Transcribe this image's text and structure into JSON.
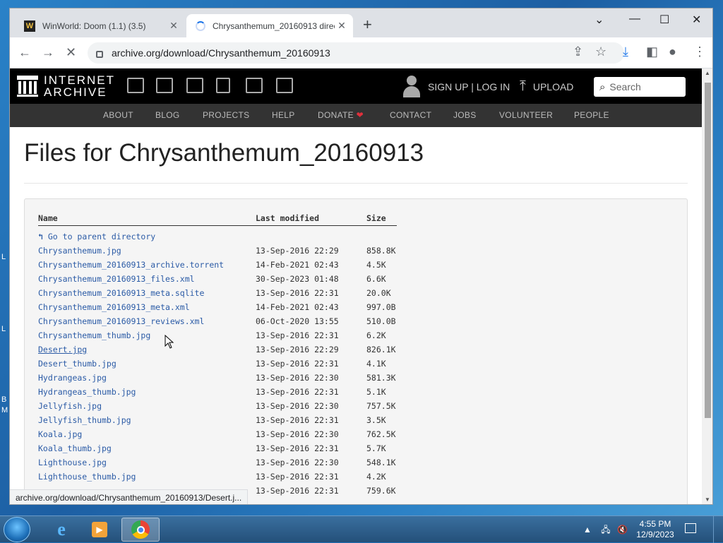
{
  "browser": {
    "tabs": [
      {
        "title": "WinWorld: Doom (1.1) (3.5)",
        "favicon": "W"
      },
      {
        "title": "Chrysanthemum_20160913 direc"
      }
    ],
    "url": "archive.org/download/Chrysanthemum_20160913",
    "status_url": "archive.org/download/Chrysanthemum_20160913/Desert.j..."
  },
  "ia": {
    "logo_line1": "INTERNET",
    "logo_line2": "ARCHIVE",
    "signup": "SIGN UP | LOG IN",
    "upload": "UPLOAD",
    "search_placeholder": "Search",
    "nav": [
      "ABOUT",
      "BLOG",
      "PROJECTS",
      "HELP",
      "DONATE",
      "CONTACT",
      "JOBS",
      "VOLUNTEER",
      "PEOPLE"
    ]
  },
  "page": {
    "title": "Files for Chrysanthemum_20160913",
    "columns": {
      "name": "Name",
      "modified": "Last modified",
      "size": "Size"
    },
    "parent": "Go to parent directory",
    "files": [
      {
        "name": "Chrysanthemum.jpg",
        "modified": "13-Sep-2016 22:29",
        "size": "858.8K"
      },
      {
        "name": "Chrysanthemum_20160913_archive.torrent",
        "modified": "14-Feb-2021 02:43",
        "size": "4.5K"
      },
      {
        "name": "Chrysanthemum_20160913_files.xml",
        "modified": "30-Sep-2023 01:48",
        "size": "6.6K"
      },
      {
        "name": "Chrysanthemum_20160913_meta.sqlite",
        "modified": "13-Sep-2016 22:31",
        "size": "20.0K"
      },
      {
        "name": "Chrysanthemum_20160913_meta.xml",
        "modified": "14-Feb-2021 02:43",
        "size": "997.0B"
      },
      {
        "name": "Chrysanthemum_20160913_reviews.xml",
        "modified": "06-Oct-2020 13:55",
        "size": "510.0B"
      },
      {
        "name": "Chrysanthemum_thumb.jpg",
        "modified": "13-Sep-2016 22:31",
        "size": "6.2K"
      },
      {
        "name": "Desert.jpg",
        "modified": "13-Sep-2016 22:29",
        "size": "826.1K"
      },
      {
        "name": "Desert_thumb.jpg",
        "modified": "13-Sep-2016 22:31",
        "size": "4.1K"
      },
      {
        "name": "Hydrangeas.jpg",
        "modified": "13-Sep-2016 22:30",
        "size": "581.3K"
      },
      {
        "name": "Hydrangeas_thumb.jpg",
        "modified": "13-Sep-2016 22:31",
        "size": "5.1K"
      },
      {
        "name": "Jellyfish.jpg",
        "modified": "13-Sep-2016 22:30",
        "size": "757.5K"
      },
      {
        "name": "Jellyfish_thumb.jpg",
        "modified": "13-Sep-2016 22:31",
        "size": "3.5K"
      },
      {
        "name": "Koala.jpg",
        "modified": "13-Sep-2016 22:30",
        "size": "762.5K"
      },
      {
        "name": "Koala_thumb.jpg",
        "modified": "13-Sep-2016 22:31",
        "size": "5.7K"
      },
      {
        "name": "Lighthouse.jpg",
        "modified": "13-Sep-2016 22:30",
        "size": "548.1K"
      },
      {
        "name": "Lighthouse_thumb.jpg",
        "modified": "13-Sep-2016 22:31",
        "size": "4.2K"
      },
      {
        "name": "",
        "modified": "13-Sep-2016 22:31",
        "size": "759.6K"
      }
    ]
  },
  "taskbar": {
    "time": "4:55 PM",
    "date": "12/9/2023"
  },
  "colors": {
    "link": "#2b5ba6",
    "donate_heart": "#e0303c"
  }
}
